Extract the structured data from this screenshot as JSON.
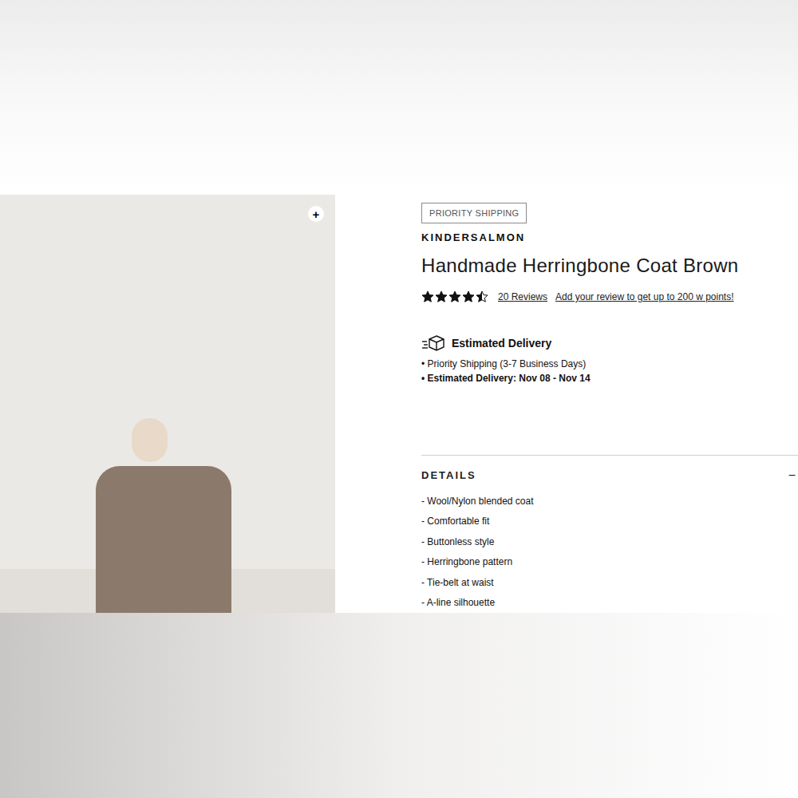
{
  "product": {
    "zoom_button": "+",
    "badge": "PRIORITY SHIPPING",
    "brand": "KINDERSALMON",
    "title": "Handmade Herringbone Coat Brown",
    "rating": {
      "stars": 4.5,
      "reviews_link": "20 Reviews",
      "review_prompt": "Add your review to get up to 200 w points!"
    },
    "delivery": {
      "heading": "Estimated Delivery",
      "items": [
        {
          "text": "• Priority Shipping (3-7 Business Days)",
          "emphasis": false
        },
        {
          "text": "• Estimated Delivery: Nov 08 - Nov 14",
          "emphasis": true
        }
      ]
    },
    "details": {
      "heading": "DETAILS",
      "toggle": "−",
      "expanded": true,
      "items": [
        "- Wool/Nylon blended coat",
        "- Comfortable fit",
        "- Buttonless style",
        "- Herringbone pattern",
        "- Tie-belt at waist",
        "- A-line silhouette"
      ]
    }
  }
}
